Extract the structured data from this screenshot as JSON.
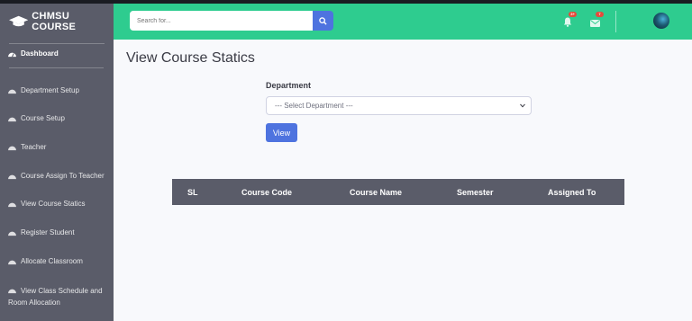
{
  "brand": {
    "name": "CHMSU COURSE"
  },
  "sidebar": {
    "items": [
      {
        "label": "Dashboard",
        "icon": "dashboard-icon"
      },
      {
        "label": "Department Setup",
        "icon": "gauge-icon"
      },
      {
        "label": "Course Setup",
        "icon": "gauge-icon"
      },
      {
        "label": "Teacher",
        "icon": "gauge-icon"
      },
      {
        "label": "Course Assign To Teacher",
        "icon": "gauge-icon"
      },
      {
        "label": "View Course Statics",
        "icon": "gauge-icon"
      },
      {
        "label": "Register Student",
        "icon": "gauge-icon"
      },
      {
        "label": "Allocate Classroom",
        "icon": "gauge-icon"
      },
      {
        "label": "View Class Schedule and Room Allocation",
        "icon": "gauge-icon"
      }
    ]
  },
  "topbar": {
    "search_placeholder": "Search for...",
    "alerts_badge": "3+",
    "messages_badge": "7"
  },
  "main": {
    "title": "View Course Statics",
    "department_label": "Department",
    "department_select": "--- Select Department ---",
    "view_button": "View",
    "table": {
      "headers": [
        "SL",
        "Course Code",
        "Course Name",
        "Semester",
        "Assigned To"
      ]
    }
  },
  "colors": {
    "topbar": "#2ecc8f",
    "sidebar": "#5a5c69",
    "primary": "#4e73df",
    "badge": "#e74a3b"
  }
}
